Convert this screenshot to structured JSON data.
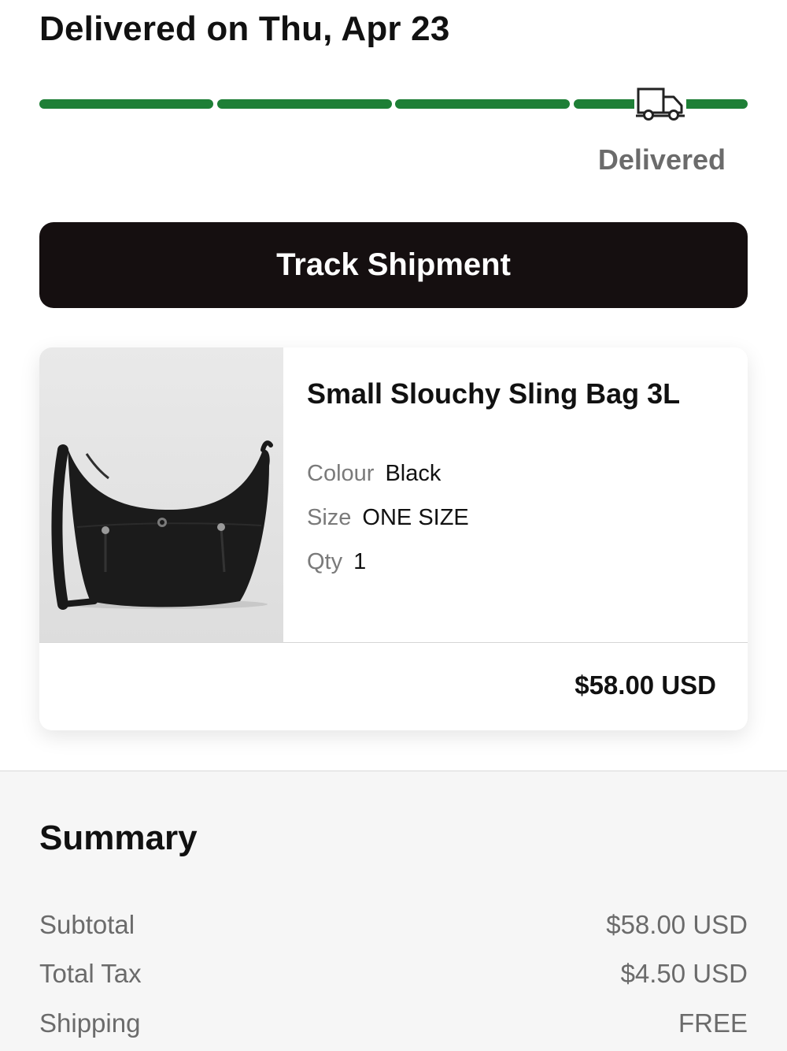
{
  "delivery": {
    "title": "Delivered on Thu, Apr 23",
    "status": "Delivered",
    "progress_fraction": 1.0,
    "progress_color": "#1e7f36",
    "status_icon": "truck-icon"
  },
  "track_button": {
    "label": "Track Shipment"
  },
  "item": {
    "name": "Small Slouchy Sling Bag 3L",
    "colour_label": "Colour",
    "colour_value": "Black",
    "size_label": "Size",
    "size_value": "ONE SIZE",
    "qty_label": "Qty",
    "qty_value": "1",
    "price": "$58.00 USD"
  },
  "summary": {
    "title": "Summary",
    "rows": [
      {
        "label": "Subtotal",
        "value": "$58.00 USD"
      },
      {
        "label": "Total Tax",
        "value": "$4.50 USD"
      },
      {
        "label": "Shipping",
        "value": "FREE"
      }
    ]
  },
  "colors": {
    "button_bg": "#150f10",
    "progress_green": "#1e7f36",
    "muted_text": "#6b6b6b"
  }
}
